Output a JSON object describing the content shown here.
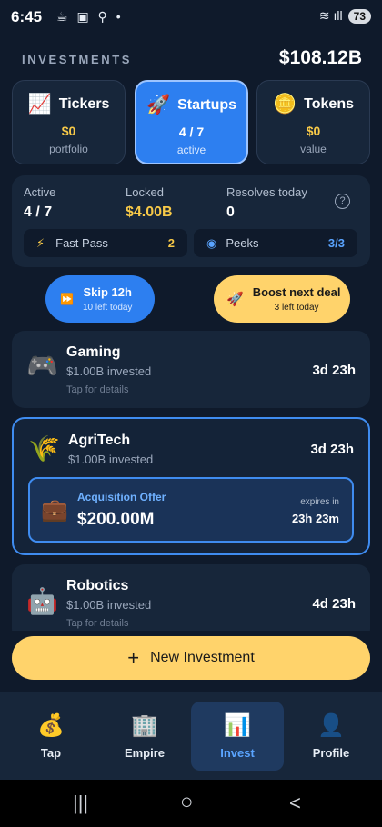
{
  "status_bar": {
    "time": "6:45",
    "left_icons": "☕ ▣ ⚲ •",
    "right_icons": "≋ ıll",
    "battery": "73"
  },
  "header": {
    "title": "INVESTMENTS",
    "total": "$108.12B"
  },
  "categories": [
    {
      "icon": "chart-icon",
      "emoji": "📈",
      "name": "Tickers",
      "value": "$0",
      "sub": "portfolio",
      "active": false
    },
    {
      "icon": "rocket-icon",
      "emoji": "🚀",
      "name": "Startups",
      "value": "4 / 7",
      "sub": "active",
      "active": true
    },
    {
      "icon": "coin-icon",
      "emoji": "🪙",
      "name": "Tokens",
      "value": "$0",
      "sub": "value",
      "active": false
    }
  ],
  "stats": {
    "active_label": "Active",
    "active_value": "4 / 7",
    "locked_label": "Locked",
    "locked_value": "$4.00B",
    "resolves_label": "Resolves today",
    "resolves_value": "0",
    "help_icon": "?",
    "fast_pass_label": "Fast Pass",
    "fast_pass_value": "2",
    "peeks_label": "Peeks",
    "peeks_value": "3/3"
  },
  "actions": {
    "skip_label": "Skip 12h",
    "skip_sub": "10 left today",
    "boost_label": "Boost next deal",
    "boost_sub": "3 left today"
  },
  "deals": [
    {
      "emoji": "🎮",
      "icon": "gamepad-icon",
      "name": "Gaming",
      "invested": "$1.00B invested",
      "tap": "Tap for details",
      "time": "3d 23h"
    },
    {
      "emoji": "🌾",
      "icon": "wheat-icon",
      "name": "AgriTech",
      "invested": "$1.00B invested",
      "time": "3d 23h",
      "offer": {
        "emoji": "💼",
        "title": "Acquisition Offer",
        "amount": "$200.00M",
        "expires_label": "expires in",
        "expires_time": "23h 23m"
      }
    },
    {
      "emoji": "🤖",
      "icon": "robot-icon",
      "name": "Robotics",
      "invested": "$1.00B invested",
      "tap": "Tap for details",
      "time": "4d 23h"
    }
  ],
  "new_investment": {
    "plus": "+",
    "label": "New Investment"
  },
  "nav": [
    {
      "emoji": "💰",
      "icon": "money-bag-icon",
      "label": "Tap"
    },
    {
      "emoji": "🏢",
      "icon": "building-icon",
      "label": "Empire"
    },
    {
      "emoji": "📊",
      "icon": "bar-chart-icon",
      "label": "Invest",
      "active": true
    },
    {
      "emoji": "👤",
      "icon": "profile-icon",
      "label": "Profile"
    }
  ],
  "colors": {
    "background": "#0f1a2b",
    "card": "#17263a",
    "accent_blue": "#2d7ff0",
    "accent_gold": "#f7c948",
    "button_yellow": "#ffd36b"
  }
}
